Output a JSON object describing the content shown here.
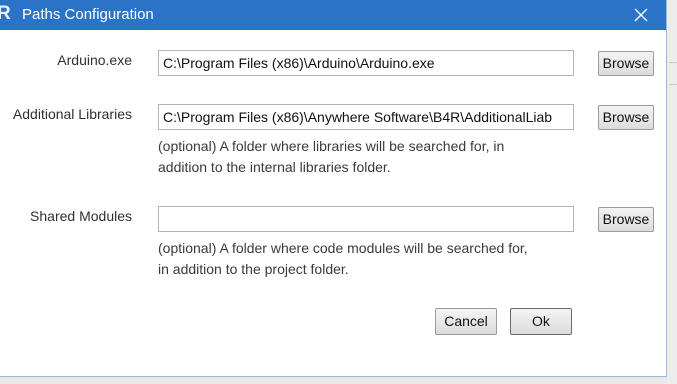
{
  "window": {
    "title": "Paths Configuration",
    "app_icon_glyph": "R",
    "accent": "#2b73c6"
  },
  "arduino": {
    "label": "Arduino.exe",
    "value": "C:\\Program Files (x86)\\Arduino\\Arduino.exe",
    "browse_label": "Browse"
  },
  "libraries": {
    "label": "Additional Libraries",
    "value": "C:\\Program Files (x86)\\Anywhere Software\\B4R\\AdditionalLiab",
    "browse_label": "Browse",
    "hint_line1": "(optional) A folder where libraries will be searched for, in",
    "hint_line2": "addition to the internal libraries folder."
  },
  "modules": {
    "label": "Shared Modules",
    "value": "",
    "browse_label": "Browse",
    "hint_line1": "(optional) A folder where code modules will be searched for,",
    "hint_line2": "in addition to the project folder."
  },
  "actions": {
    "cancel_label": "Cancel",
    "ok_label": "Ok"
  }
}
